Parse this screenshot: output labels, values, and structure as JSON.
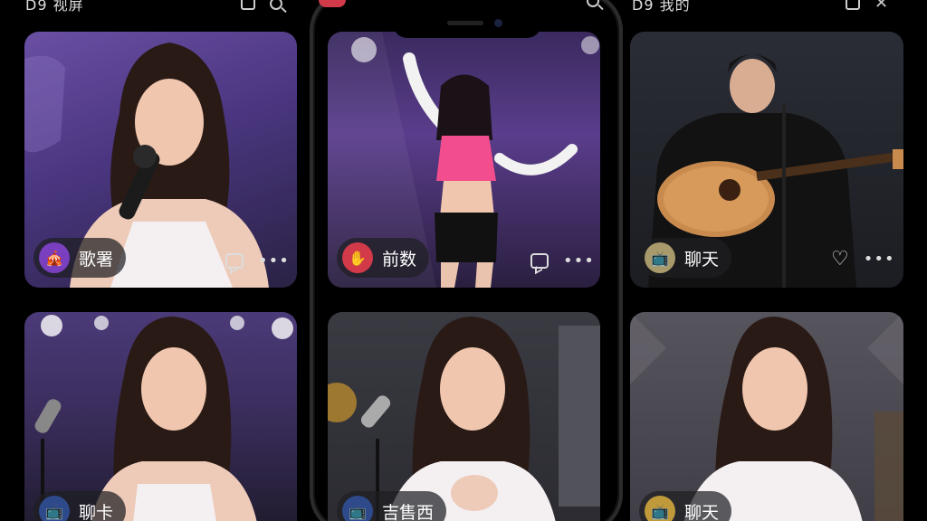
{
  "columns": [
    {
      "title": "D9 视屏"
    },
    {
      "title": ""
    },
    {
      "title": "D9 我的"
    }
  ],
  "cards": [
    {
      "label": "歌署",
      "logo_icon": "stage-icon"
    },
    {
      "label": "前数",
      "logo_icon": "dance-icon"
    },
    {
      "label": "聊天",
      "logo_icon": "tv-icon"
    },
    {
      "label": "聊卡",
      "logo_icon": "tv-icon"
    },
    {
      "label": "吉售西",
      "logo_icon": "tv-icon"
    },
    {
      "label": "聊天",
      "logo_icon": "tv-icon"
    }
  ],
  "colors": {
    "card_purple": "#5a3d8c",
    "card_dark": "#2a2a30",
    "badge_bg": "#1e1e23",
    "dance_logo": "#d23a4a",
    "stage_logo": "#7a3fbf"
  }
}
